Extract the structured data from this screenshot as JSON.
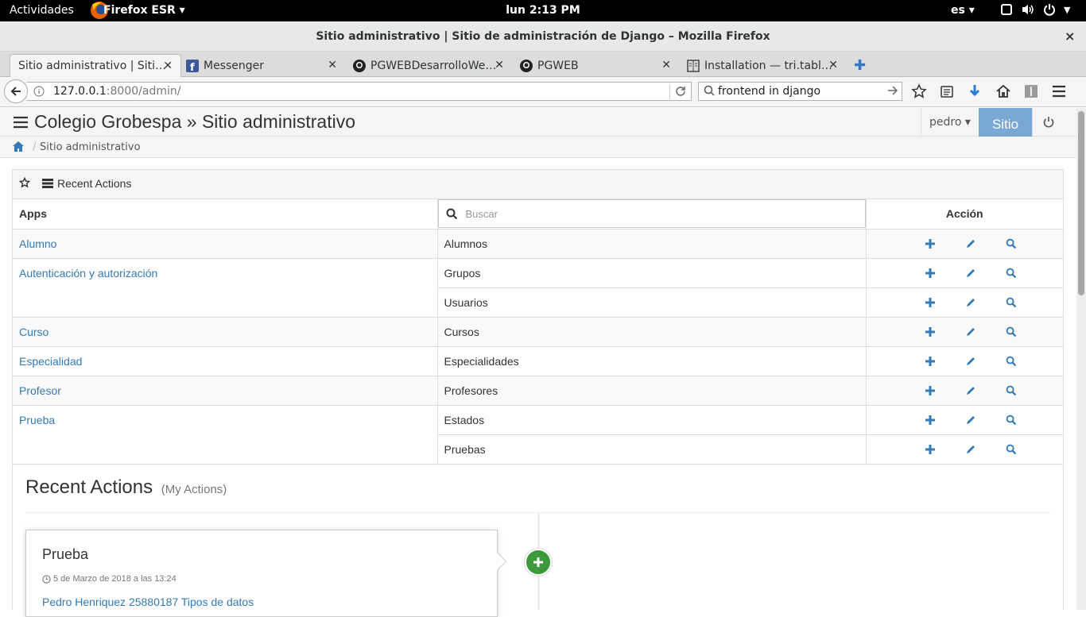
{
  "system": {
    "activities": "Actividades",
    "app_name": "Firefox ESR ▾",
    "clock": "lun  2:13 PM",
    "lang": "es ▾"
  },
  "window": {
    "title": "Sitio administrativo | Sitio de administración de Django – Mozilla Firefox",
    "close": "×"
  },
  "tabs": [
    {
      "label": "Sitio administrativo | Siti…",
      "icon": "django-icon"
    },
    {
      "label": "Messenger",
      "icon": "facebook-icon"
    },
    {
      "label": "PGWEBDesarrolloWe…",
      "icon": "github-icon"
    },
    {
      "label": "PGWEB",
      "icon": "github-icon"
    },
    {
      "label": "Installation — tri.tabl…",
      "icon": "docs-icon"
    }
  ],
  "navbar": {
    "url_host": "127.0.0.1",
    "url_rest": ":8000/admin/",
    "search_value": "frontend in django"
  },
  "admin": {
    "brand": "Colegio Grobespa » Sitio administrativo",
    "user": "pedro ▾",
    "site_button": "Sitio",
    "breadcrumb": "Sitio administrativo",
    "panel_title": "Recent Actions",
    "col_apps": "Apps",
    "search_placeholder": "Buscar",
    "col_action": "Acción",
    "rows": [
      {
        "app": "Alumno",
        "model": "Alumnos"
      },
      {
        "app": "Autenticación y autorización",
        "model": "Grupos"
      },
      {
        "app": "",
        "model": "Usuarios"
      },
      {
        "app": "Curso",
        "model": "Cursos"
      },
      {
        "app": "Especialidad",
        "model": "Especialidades"
      },
      {
        "app": "Profesor",
        "model": "Profesores"
      },
      {
        "app": "Prueba",
        "model": "Estados"
      },
      {
        "app": "",
        "model": "Pruebas"
      }
    ]
  },
  "recent": {
    "heading": "Recent Actions",
    "sub": "(My Actions)",
    "card_title": "Prueba",
    "card_date": "5 de Marzo de 2018 a las 13:24",
    "card_link": "Pedro Henriquez 25880187 Tipos de datos"
  },
  "colors": {
    "link": "#337ab7",
    "site_button": "#7aa8d4",
    "add_badge": "#3c9a3c"
  }
}
